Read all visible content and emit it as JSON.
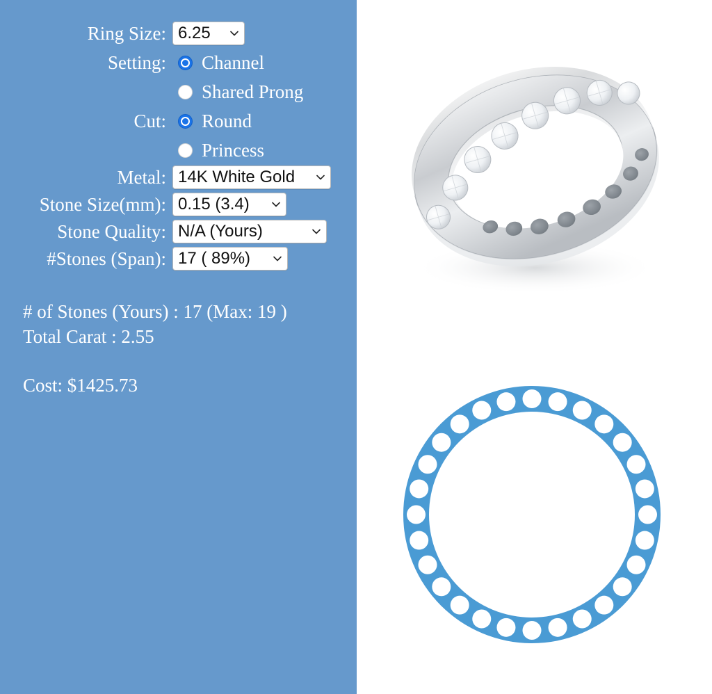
{
  "panel": {
    "background_color": "#6699cc",
    "text_color": "#ffffff"
  },
  "form": {
    "rows": [
      {
        "label": "Ring Size:",
        "type": "select",
        "value": "6.25"
      },
      {
        "label": "Setting:",
        "type": "radio"
      },
      {
        "label": "Cut:",
        "type": "radio"
      },
      {
        "label": "Metal:",
        "type": "select",
        "value": "14K White Gold"
      },
      {
        "label": "Stone Size(mm):",
        "type": "select",
        "value": "0.15 (3.4)"
      },
      {
        "label": "Stone Quality:",
        "type": "select",
        "value": "N/A (Yours)"
      },
      {
        "label": "#Stones (Span):",
        "type": "select",
        "value": "17 ( 89%)"
      }
    ],
    "ring_size": {
      "label": "Ring Size:",
      "value": "6.25"
    },
    "setting": {
      "label": "Setting:",
      "options": [
        {
          "label": "Channel",
          "selected": true
        },
        {
          "label": "Shared Prong",
          "selected": false
        }
      ]
    },
    "cut": {
      "label": "Cut:",
      "options": [
        {
          "label": "Round",
          "selected": true
        },
        {
          "label": "Princess",
          "selected": false
        }
      ]
    },
    "metal": {
      "label": "Metal:",
      "value": "14K White Gold"
    },
    "stone_size": {
      "label": "Stone Size(mm):",
      "value": "0.15 (3.4)"
    },
    "stone_quality": {
      "label": "Stone Quality:",
      "value": "N/A (Yours)"
    },
    "num_stones": {
      "label": "#Stones (Span):",
      "value": "17 ( 89%)"
    }
  },
  "summary": {
    "stones_line": "# of Stones (Yours) : 17 (Max: 19 )",
    "carat_line": "Total Carat : 2.55",
    "cost_line": "Cost: $1425.73"
  },
  "preview": {
    "photo_alt": "channel-set round diamond eternity band, white gold",
    "diagram": {
      "accent_color": "#4a9bd4",
      "hole_color": "#ffffff",
      "hole_count": 28
    }
  },
  "icons": {
    "chevron_down": "chevron-down-icon",
    "radio_selected": "radio-selected-icon",
    "radio_unselected": "radio-unselected-icon"
  }
}
